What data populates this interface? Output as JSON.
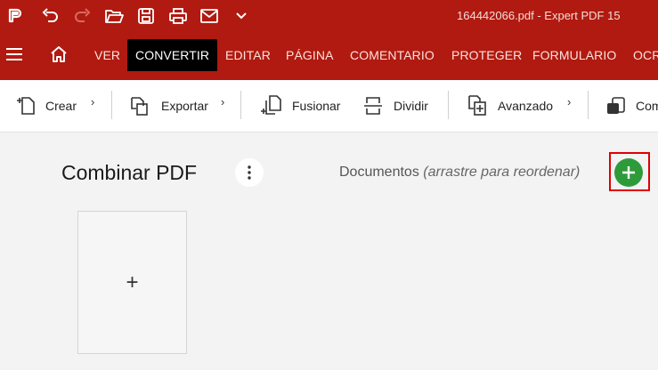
{
  "titlebar": {
    "app_title": "164442066.pdf   -   Expert PDF 15",
    "icons": [
      "app-logo-icon",
      "undo-icon",
      "redo-icon",
      "open-folder-icon",
      "save-icon",
      "print-icon",
      "mail-icon",
      "chevron-down-icon"
    ]
  },
  "ribbon": {
    "tabs": [
      "VER",
      "CONVERTIR",
      "EDITAR",
      "PÁGINA",
      "COMENTARIO",
      "PROTEGER",
      "FORMULARIO",
      "OCR"
    ],
    "active_tab": "CONVERTIR"
  },
  "toolbar": {
    "crear": "Crear",
    "exportar": "Exportar",
    "fusionar": "Fusionar",
    "dividir": "Dividir",
    "avanzado": "Avanzado",
    "comprimir": "Com"
  },
  "panel": {
    "heading": "Combinar PDF",
    "documents_label": "Documentos",
    "documents_hint": "(arrastre para reordenar)",
    "drop_symbol": "+"
  },
  "colors": {
    "ribbon": "#b01a10",
    "active_tab": "#000000",
    "add_button": "#2e9b3a",
    "highlight": "#e00000"
  }
}
